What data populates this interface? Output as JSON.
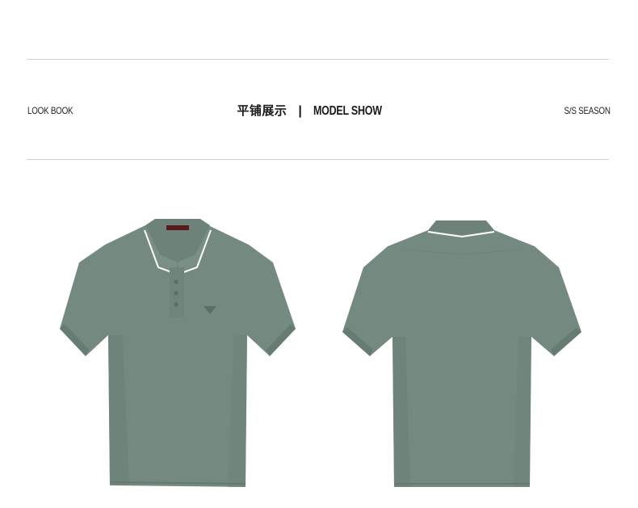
{
  "header": {
    "left_label": "LOOK BOOK",
    "title_cn": "平铺展示",
    "separator": "|",
    "title_en": "MODEL SHOW",
    "right_label": "S/S SEASON"
  },
  "products": [
    {
      "view": "front",
      "color": "#748a81"
    },
    {
      "view": "back",
      "color": "#748a81"
    }
  ],
  "colors": {
    "shirt": "#748a81",
    "shirt_shadow": "#667b72",
    "trim": "#ffffff",
    "rule": "#cfcfcf"
  }
}
